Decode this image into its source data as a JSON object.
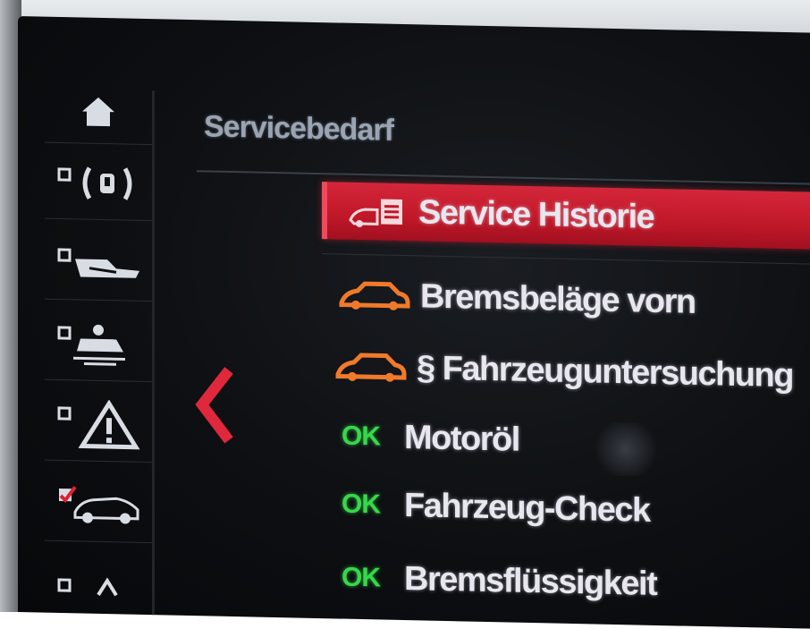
{
  "header": {
    "title": "Servicebedarf"
  },
  "sidebar": {
    "items": [
      {
        "icon": "home-icon"
      },
      {
        "icon": "tire-pressure-icon"
      },
      {
        "icon": "vehicle-settings-icon"
      },
      {
        "icon": "driver-assist-icon"
      },
      {
        "icon": "warning-triangle-icon"
      },
      {
        "icon": "vehicle-status-icon"
      }
    ]
  },
  "list": {
    "items": [
      {
        "label": "Service Historie",
        "status_icon": "service-history-icon",
        "selected": true
      },
      {
        "label": "Bremsbeläge vorn",
        "status_icon": "car-orange-icon"
      },
      {
        "label": "§ Fahrzeuguntersuchung",
        "status_icon": "car-orange-icon"
      },
      {
        "label": "Motoröl",
        "status": "OK"
      },
      {
        "label": "Fahrzeug-Check",
        "status": "OK"
      },
      {
        "label": "Bremsflüssigkeit",
        "status": "OK"
      }
    ]
  },
  "colors": {
    "selected_bg": "#c01828",
    "ok_green": "#36d84a",
    "warning_orange": "#f07a2a",
    "text": "#e8e6ee"
  }
}
